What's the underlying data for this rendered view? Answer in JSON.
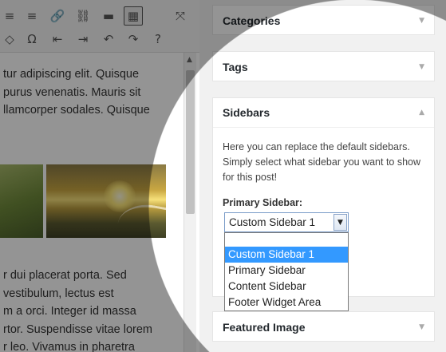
{
  "toolbar": {
    "row1": [
      "align-left-icon",
      "align-right-icon",
      "insert-link-icon",
      "remove-link-icon",
      "read-more-icon",
      "toolbar-toggle-icon",
      "fullscreen-icon"
    ],
    "row2": [
      "clear-formatting-icon",
      "special-character-icon",
      "outdent-icon",
      "indent-icon",
      "undo-icon",
      "redo-icon",
      "help-icon"
    ]
  },
  "editor": {
    "paragraph1": [
      "tur adipiscing elit. Quisque",
      "purus venenatis. Mauris sit",
      "llamcorper sodales. Quisque"
    ],
    "paragraph2": [
      "r dui placerat porta. Sed",
      "vestibulum, lectus est",
      "m a orci. Integer id massa",
      "rtor. Suspendisse vitae lorem",
      "r leo. Vivamus in pharetra"
    ]
  },
  "metaboxes": {
    "categories": {
      "title": "Categories"
    },
    "tags": {
      "title": "Tags"
    },
    "sidebars": {
      "title": "Sidebars",
      "description": "Here you can replace the default sidebars. Simply select what sidebar you want to show for this post!",
      "primary_label": "Primary Sidebar:",
      "selected_value": "Custom Sidebar 1",
      "options": [
        "Custom Sidebar 1",
        "Primary Sidebar",
        "Content Sidebar",
        "Footer Widget Area"
      ]
    },
    "featured_image": {
      "title": "Featured Image"
    }
  },
  "colors": {
    "selection": "#3399ff",
    "overlay": "rgba(0,0,0,0.42)"
  }
}
